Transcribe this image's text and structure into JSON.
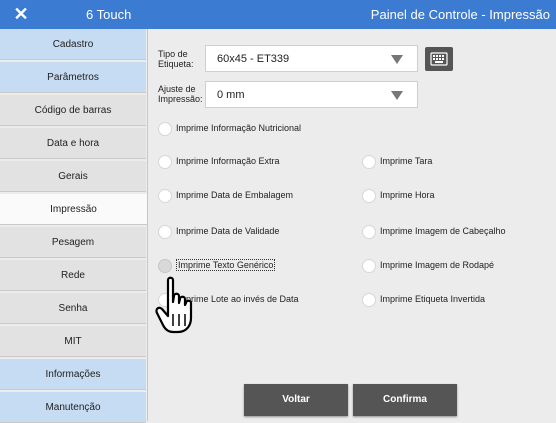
{
  "titlebar": {
    "close_symbol": "✕",
    "device_name": "6 Touch",
    "title": "Painel de Controle - Impressão"
  },
  "sidebar": {
    "items": [
      {
        "label": "Cadastro"
      },
      {
        "label": "Parâmetros"
      },
      {
        "label": "Código de barras"
      },
      {
        "label": "Data e hora"
      },
      {
        "label": "Gerais"
      },
      {
        "label": "Impressão"
      },
      {
        "label": "Pesagem"
      },
      {
        "label": "Rede"
      },
      {
        "label": "Senha"
      },
      {
        "label": "MIT"
      },
      {
        "label": "Informações"
      },
      {
        "label": "Manutenção"
      }
    ]
  },
  "form": {
    "label_type_label": "Tipo de Etiqueta:",
    "label_type_value": "60x45 - ET339",
    "print_adjust_label": "Ajuste de Impressão:",
    "print_adjust_value": "0 mm"
  },
  "options": {
    "nutritional": "Imprime Informação Nutricional",
    "extra_info": "Imprime Informação Extra",
    "tare": "Imprime Tara",
    "packaging_date": "Imprime Data de Embalagem",
    "time": "Imprime Hora",
    "expiry_date": "Imprime Data de Validade",
    "header_image": "Imprime Imagem de Cabeçalho",
    "generic_text": "Imprime Texto Genérico",
    "footer_image": "Imprime Imagem de Rodapé",
    "lot_instead_of_date": "Imprime Lote ao invés de Data",
    "inverted_label": "Imprime Etiqueta Invertida"
  },
  "buttons": {
    "back": "Voltar",
    "confirm": "Confirma"
  },
  "colors": {
    "titlebar": "#3b7bd1",
    "sidebar_highlight": "#c6dcf3",
    "button": "#555555"
  },
  "icons": {
    "close": "close-icon",
    "keyboard": "keyboard-icon",
    "cursor": "hand-pointer-icon"
  }
}
